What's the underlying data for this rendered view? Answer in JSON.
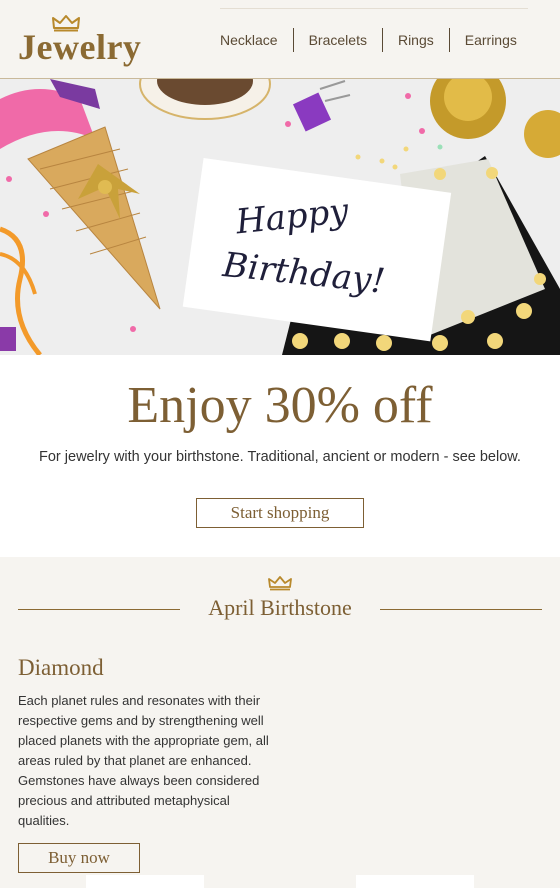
{
  "header": {
    "logo_text": "Jewelry",
    "nav": [
      {
        "label": "Necklace"
      },
      {
        "label": "Bracelets"
      },
      {
        "label": "Rings"
      },
      {
        "label": "Earrings"
      }
    ]
  },
  "hero": {
    "card_line1": "Happy",
    "card_line2": "Birthday!"
  },
  "offer": {
    "title": "Enjoy 30% off",
    "subtitle": "For jewelry with your birthstone. Traditional, ancient or modern - see below.",
    "cta": "Start shopping"
  },
  "birthstone": {
    "section_title": "April Birthstone",
    "stone_name": "Diamond",
    "description": "Each planet rules and resonates with their respective gems and by strengthening well placed planets with the appropriate gem, all areas ruled by that planet are enhanced. Gemstones have always been considered precious and attributed metaphysical qualities.",
    "cta": "Buy now"
  },
  "colors": {
    "brand_brown": "#7d5f34",
    "gold": "#c79a2e",
    "background": "#f6f4f0"
  }
}
